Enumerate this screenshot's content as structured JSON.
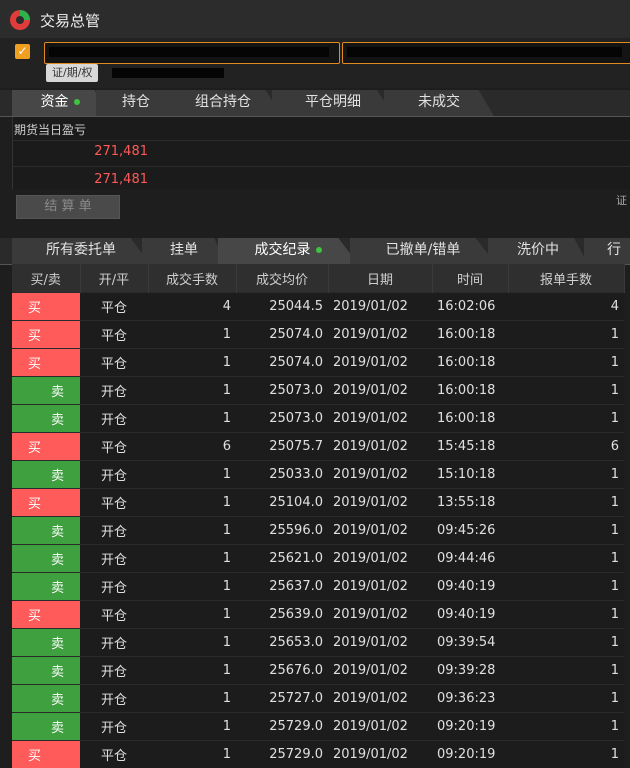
{
  "window": {
    "title": "交易总管"
  },
  "account": {
    "tag": "证/期/权"
  },
  "top_tabs": [
    {
      "label": "资金",
      "dot": true
    },
    {
      "label": "持仓",
      "dot": false
    },
    {
      "label": "组合持仓",
      "dot": false
    },
    {
      "label": "平仓明细",
      "dot": false
    },
    {
      "label": "未成交",
      "dot": false
    }
  ],
  "funds": {
    "header": "期货当日盈亏",
    "values": [
      "271,481",
      "271,481"
    ],
    "settle_label": "结 算 单",
    "side_hint": "证"
  },
  "order_tabs": [
    {
      "label": "所有委托单",
      "dot": false
    },
    {
      "label": "挂单",
      "dot": false
    },
    {
      "label": "成交纪录",
      "dot": true
    },
    {
      "label": "已撤单/错单",
      "dot": false
    },
    {
      "label": "洗价中",
      "dot": false
    },
    {
      "label": "行",
      "dot": false
    }
  ],
  "table": {
    "columns": [
      "买/卖",
      "开/平",
      "成交手数",
      "成交均价",
      "日期",
      "时间",
      "报单手数"
    ],
    "rows": [
      {
        "side": "买",
        "oc": "平仓",
        "qty": "4",
        "price": "25044.5",
        "date": "2019/01/02",
        "time": "16:02:06",
        "order_qty": "4"
      },
      {
        "side": "买",
        "oc": "平仓",
        "qty": "1",
        "price": "25074.0",
        "date": "2019/01/02",
        "time": "16:00:18",
        "order_qty": "1"
      },
      {
        "side": "买",
        "oc": "平仓",
        "qty": "1",
        "price": "25074.0",
        "date": "2019/01/02",
        "time": "16:00:18",
        "order_qty": "1"
      },
      {
        "side": "卖",
        "oc": "开仓",
        "qty": "1",
        "price": "25073.0",
        "date": "2019/01/02",
        "time": "16:00:18",
        "order_qty": "1"
      },
      {
        "side": "卖",
        "oc": "开仓",
        "qty": "1",
        "price": "25073.0",
        "date": "2019/01/02",
        "time": "16:00:18",
        "order_qty": "1"
      },
      {
        "side": "买",
        "oc": "平仓",
        "qty": "6",
        "price": "25075.7",
        "date": "2019/01/02",
        "time": "15:45:18",
        "order_qty": "6"
      },
      {
        "side": "卖",
        "oc": "开仓",
        "qty": "1",
        "price": "25033.0",
        "date": "2019/01/02",
        "time": "15:10:18",
        "order_qty": "1"
      },
      {
        "side": "买",
        "oc": "平仓",
        "qty": "1",
        "price": "25104.0",
        "date": "2019/01/02",
        "time": "13:55:18",
        "order_qty": "1"
      },
      {
        "side": "卖",
        "oc": "开仓",
        "qty": "1",
        "price": "25596.0",
        "date": "2019/01/02",
        "time": "09:45:26",
        "order_qty": "1"
      },
      {
        "side": "卖",
        "oc": "开仓",
        "qty": "1",
        "price": "25621.0",
        "date": "2019/01/02",
        "time": "09:44:46",
        "order_qty": "1"
      },
      {
        "side": "卖",
        "oc": "开仓",
        "qty": "1",
        "price": "25637.0",
        "date": "2019/01/02",
        "time": "09:40:19",
        "order_qty": "1"
      },
      {
        "side": "买",
        "oc": "平仓",
        "qty": "1",
        "price": "25639.0",
        "date": "2019/01/02",
        "time": "09:40:19",
        "order_qty": "1"
      },
      {
        "side": "卖",
        "oc": "开仓",
        "qty": "1",
        "price": "25653.0",
        "date": "2019/01/02",
        "time": "09:39:54",
        "order_qty": "1"
      },
      {
        "side": "卖",
        "oc": "开仓",
        "qty": "1",
        "price": "25676.0",
        "date": "2019/01/02",
        "time": "09:39:28",
        "order_qty": "1"
      },
      {
        "side": "卖",
        "oc": "开仓",
        "qty": "1",
        "price": "25727.0",
        "date": "2019/01/02",
        "time": "09:36:23",
        "order_qty": "1"
      },
      {
        "side": "卖",
        "oc": "开仓",
        "qty": "1",
        "price": "25729.0",
        "date": "2019/01/02",
        "time": "09:20:19",
        "order_qty": "1"
      },
      {
        "side": "买",
        "oc": "平仓",
        "qty": "1",
        "price": "25729.0",
        "date": "2019/01/02",
        "time": "09:20:19",
        "order_qty": "1"
      }
    ]
  },
  "colors": {
    "buy": "#ff5b5b",
    "sell": "#3fa03f",
    "accent": "#f0a020",
    "loss_text": "#ff5a5a"
  }
}
